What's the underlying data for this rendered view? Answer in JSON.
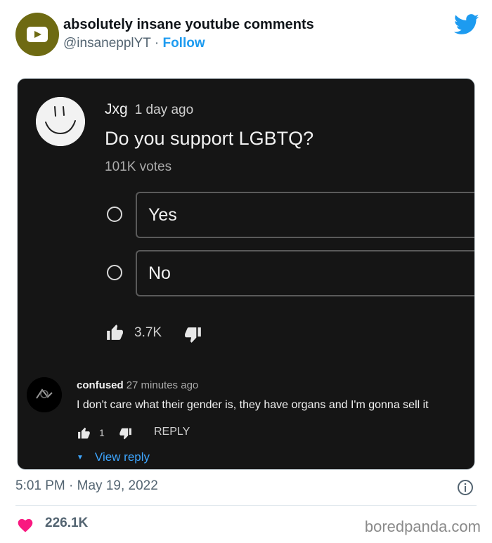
{
  "tweet": {
    "account_name": "absolutely insane youtube comments",
    "handle": "@insanepplYT",
    "separator": "·",
    "follow_label": "Follow",
    "timestamp": "5:01 PM · May 19, 2022",
    "likes": "226.1K",
    "watermark": "boredpanda.com"
  },
  "screenshot": {
    "poll": {
      "author": "Jxg",
      "time": "1 day ago",
      "question": "Do you support LGBTQ?",
      "votes": "101K votes",
      "options": [
        {
          "label": "Yes"
        },
        {
          "label": "No"
        }
      ],
      "likes": "3.7K"
    },
    "reply": {
      "author": "confused",
      "time": "27 minutes ago",
      "text": "I don't care what their gender is, they have organs and I'm gonna sell it",
      "likes": "1",
      "reply_label": "REPLY",
      "view_reply_label": "View reply"
    }
  },
  "icons": {
    "twitter": "twitter-bird-icon",
    "info": "info-icon",
    "heart": "heart-icon",
    "thumb_up": "thumbs-up-icon",
    "thumb_down": "thumbs-down-icon"
  },
  "colors": {
    "twitter_blue": "#1d9bf0",
    "heart": "#f91880",
    "avatar_olive": "#6e6a12",
    "screenshot_bg": "#151515",
    "link_blue": "#3ea6ff"
  }
}
